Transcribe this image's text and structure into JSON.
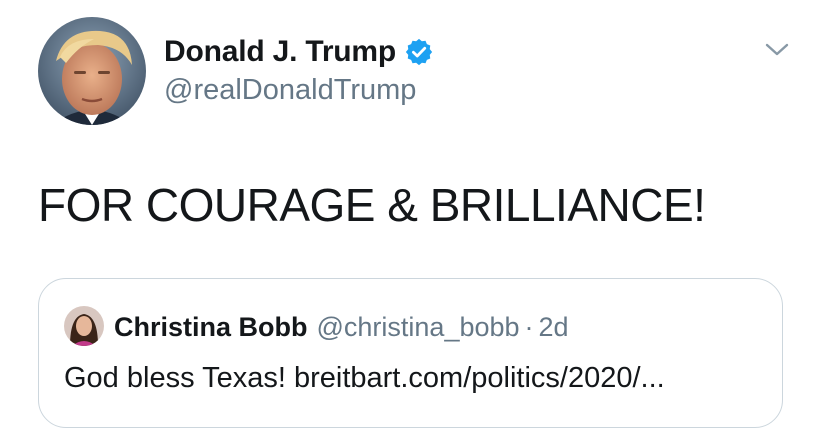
{
  "tweet": {
    "author": {
      "name": "Donald J. Trump",
      "handle": "@realDonaldTrump",
      "verified": true
    },
    "text": "FOR COURAGE & BRILLIANCE!",
    "menu_icon": "chevron-down-icon"
  },
  "quoted_tweet": {
    "author_name": "Christina Bobb",
    "author_handle": "@christina_bobb",
    "separator": "·",
    "time": "2d",
    "text": "God bless Texas! breitbart.com/politics/2020/..."
  },
  "colors": {
    "verified_blue": "#1da1f2",
    "secondary_text": "#657786",
    "primary_text": "#14171a",
    "border": "#ccd6dd"
  }
}
